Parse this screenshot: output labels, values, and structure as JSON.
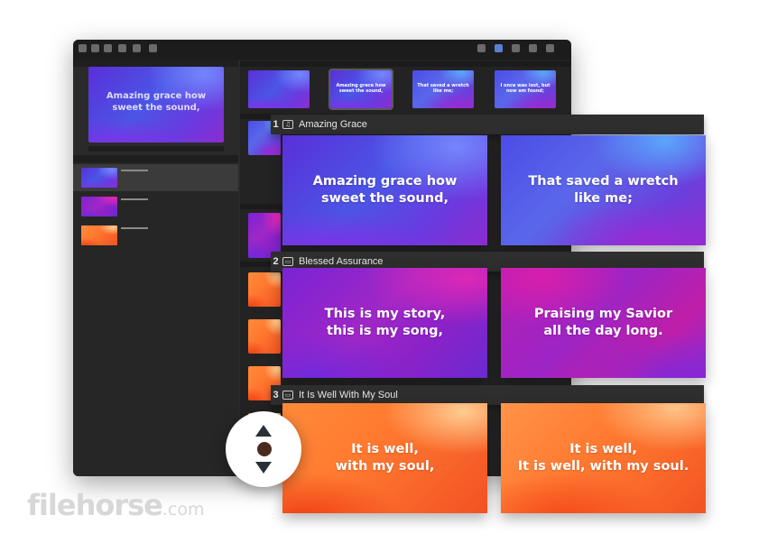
{
  "background_app": {
    "preview": {
      "text": "Amazing grace how\nsweet the sound,"
    },
    "thumbnails": [
      {
        "text": ""
      },
      {
        "text": "Amazing grace how sweet the sound,"
      },
      {
        "text": "That saved a wretch like me;"
      },
      {
        "text": "I once was lost, but now am found;"
      }
    ]
  },
  "groups": [
    {
      "number": "1",
      "title": "Amazing Grace",
      "icon": "music-note-icon",
      "slides": [
        {
          "text": "Amazing grace how\nsweet the sound,"
        },
        {
          "text": "That saved a wretch\nlike me;"
        }
      ]
    },
    {
      "number": "2",
      "title": "Blessed Assurance",
      "icon": "slides-icon",
      "slides": [
        {
          "text": "This is my story,\nthis is my song,"
        },
        {
          "text": "Praising my Savior\nall the day long."
        }
      ]
    },
    {
      "number": "3",
      "title": "It Is Well With My Soul",
      "icon": "slides-icon",
      "slides": [
        {
          "text": "It is well,\nwith my soul,"
        },
        {
          "text": "It is well,\nIt is well, with my soul."
        }
      ]
    }
  ],
  "reorder": {
    "up_icon": "arrow-up-icon",
    "handle_icon": "drag-handle-icon",
    "down_icon": "arrow-down-icon"
  },
  "watermark": {
    "name": "filehorse",
    "tld": ".com"
  }
}
